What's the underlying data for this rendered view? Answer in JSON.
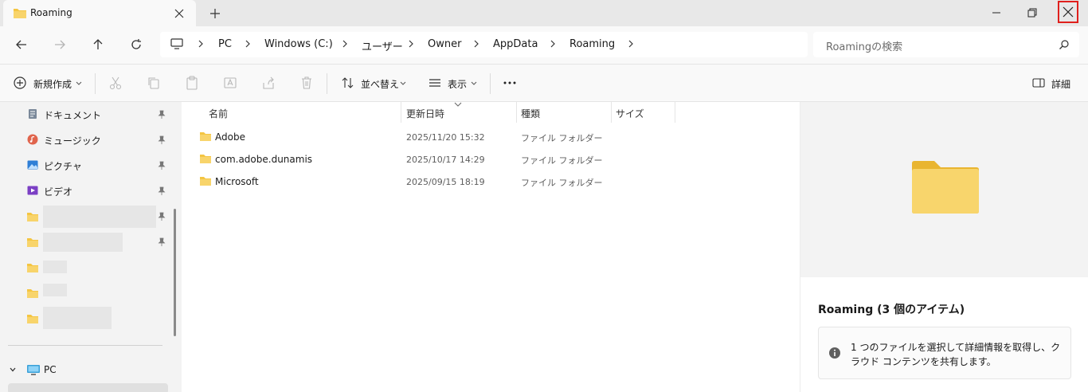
{
  "tab": {
    "title": "Roaming"
  },
  "breadcrumb": [
    "PC",
    "Windows (C:)",
    "ユーザー",
    "Owner",
    "AppData",
    "Roaming"
  ],
  "search": {
    "placeholder": "Roamingの検索"
  },
  "toolbar": {
    "new_label": "新規作成",
    "sort_label": "並べ替え",
    "view_label": "表示",
    "details_label": "詳細"
  },
  "nav": {
    "items": [
      {
        "label": "ドキュメント",
        "icon": "document-icon"
      },
      {
        "label": "ミュージック",
        "icon": "music-icon"
      },
      {
        "label": "ピクチャ",
        "icon": "pictures-icon"
      },
      {
        "label": "ビデオ",
        "icon": "video-icon"
      }
    ],
    "pc_label": "PC"
  },
  "columns": {
    "name": "名前",
    "date": "更新日時",
    "type": "種類",
    "size": "サイズ"
  },
  "files": [
    {
      "name": "Adobe",
      "date": "2025/11/20 15:32",
      "type": "ファイル フォルダー"
    },
    {
      "name": "com.adobe.dunamis",
      "date": "2025/10/17 14:29",
      "type": "ファイル フォルダー"
    },
    {
      "name": "Microsoft",
      "date": "2025/09/15 18:19",
      "type": "ファイル フォルダー"
    }
  ],
  "details_pane": {
    "title": "Roaming (3 個のアイテム)",
    "info": "1 つのファイルを選択して詳細情報を取得し、クラウド コンテンツを共有します。"
  },
  "colors": {
    "folder": "#f4c542",
    "accent": "#0067c0",
    "close_highlight": "#e0201d"
  }
}
